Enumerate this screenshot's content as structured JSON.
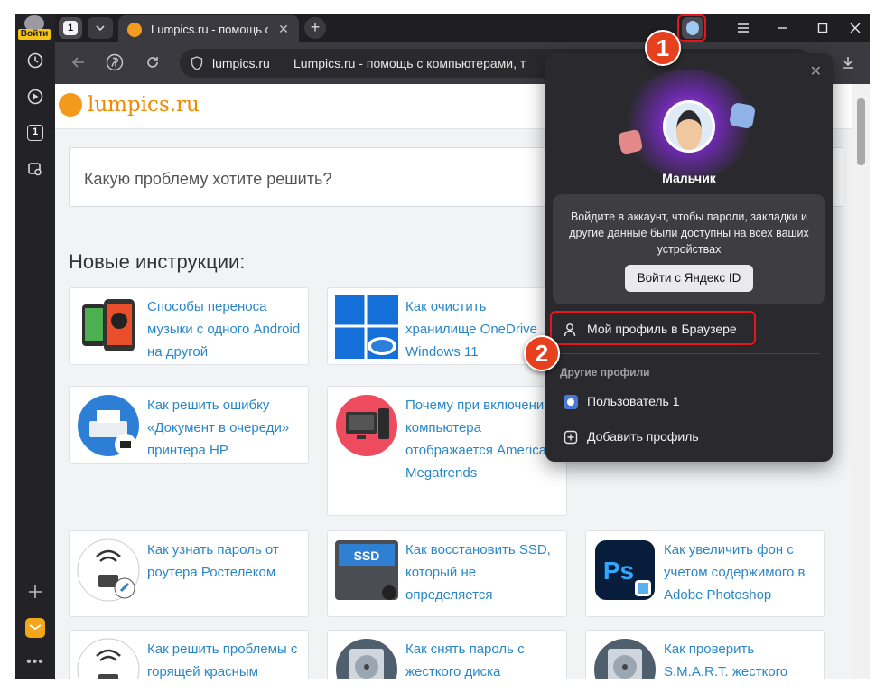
{
  "sidebar": {
    "login_label": "Войти",
    "icons": [
      "history-icon",
      "play-icon",
      "tab-counter-icon",
      "screenshot-icon",
      "add-icon",
      "mail-icon",
      "more-icon"
    ],
    "tab_counter": "1"
  },
  "tabstrip": {
    "tab_count": "1",
    "active_tab_title": "Lumpics.ru - помощь с компьютерами",
    "new_tab_symbol": "+"
  },
  "address_bar": {
    "domain": "lumpics.ru",
    "page_title": "Lumpics.ru - помощь с компьютерами, т"
  },
  "page": {
    "logo_text": "lumpics.ru",
    "search_placeholder": "Какую проблему хотите решить?",
    "section_title": "Новые инструкции:",
    "cards": [
      {
        "text": "Способы переноса музыки с одного Android на другой"
      },
      {
        "text": "Как очистить хранилище OneDrive Windows 11"
      },
      {
        "text": "Как решить ошибку «Документ в очереди» принтера HP"
      },
      {
        "text": "Почему при включении компьютера отображается American Megatrends"
      },
      {
        "text": "Как узнать пароль от роутера Ростелеком"
      },
      {
        "text": "Как восстановить SSD, который не определяется"
      },
      {
        "text": "Как увеличить фон с учетом содержимого в Adobe Photoshop"
      },
      {
        "text": "Как решить проблемы с горящей красным"
      },
      {
        "text": "Как снять пароль с жесткого диска"
      },
      {
        "text": "Как проверить S.M.A.R.T. жесткого"
      }
    ]
  },
  "profile_popup": {
    "profile_name": "Мальчик",
    "signin_message": "Войдите в аккаунт, чтобы пароли, закладки и другие данные были доступны на всех ваших устройствах",
    "signin_button": "Войти с Яндекс ID",
    "my_profile": "Мой профиль в Браузере",
    "other_profiles_header": "Другие профили",
    "other_profile_user": "Пользователь 1",
    "add_profile": "Добавить профиль"
  },
  "callouts": {
    "marker_1": "1",
    "marker_2": "2"
  },
  "colors": {
    "accent_link": "#2a87c7",
    "logo_orange": "#ef8a00",
    "callout_red": "#e3171c",
    "browser_dark": "#2b2b2f"
  }
}
